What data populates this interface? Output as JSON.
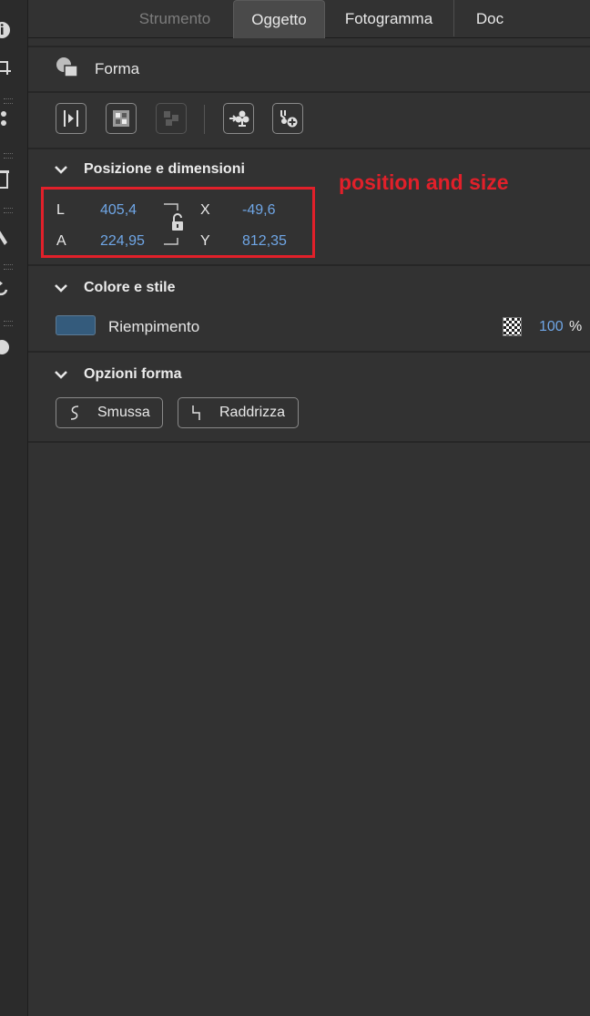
{
  "tabs": [
    {
      "label": "Strumento",
      "state": "inactive"
    },
    {
      "label": "Oggetto",
      "state": "active"
    },
    {
      "label": "Fotogramma",
      "state": "normal"
    },
    {
      "label": "Doc",
      "state": "normal"
    }
  ],
  "object_type": {
    "label": "Forma",
    "icon": "shape-icon"
  },
  "toolbar": {
    "buttons": [
      {
        "icon": "align-edges-icon",
        "enabled": true
      },
      {
        "icon": "distribute-icon",
        "enabled": true
      },
      {
        "icon": "arrange-icon",
        "enabled": false
      },
      {
        "icon": "convert-to-symbol-icon",
        "enabled": true
      },
      {
        "icon": "add-to-symbol-icon",
        "enabled": true
      }
    ]
  },
  "position_size": {
    "title": "Posizione e dimensioni",
    "width_label": "L",
    "width_value": "405,4",
    "height_label": "A",
    "height_value": "224,95",
    "x_label": "X",
    "x_value": "-49,6",
    "y_label": "Y",
    "y_value": "812,35",
    "lock_state": "unlocked",
    "annotation": "position and size"
  },
  "color_style": {
    "title": "Colore e stile",
    "fill_label": "Riempimento",
    "fill_color": "#345b7c",
    "opacity_value": "100",
    "opacity_unit": "%"
  },
  "shape_options": {
    "title": "Opzioni forma",
    "smooth_label": "Smussa",
    "straighten_label": "Raddrizza"
  },
  "colors": {
    "panel_bg": "#323232",
    "value_blue": "#6fa6e6",
    "annotation_red": "#e1202a"
  }
}
